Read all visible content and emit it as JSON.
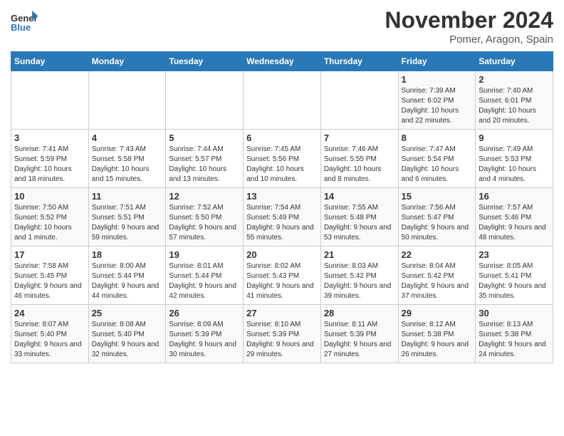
{
  "header": {
    "logo_general": "General",
    "logo_blue": "Blue",
    "title": "November 2024",
    "location": "Pomer, Aragon, Spain"
  },
  "weekdays": [
    "Sunday",
    "Monday",
    "Tuesday",
    "Wednesday",
    "Thursday",
    "Friday",
    "Saturday"
  ],
  "weeks": [
    [
      {
        "day": "",
        "info": ""
      },
      {
        "day": "",
        "info": ""
      },
      {
        "day": "",
        "info": ""
      },
      {
        "day": "",
        "info": ""
      },
      {
        "day": "",
        "info": ""
      },
      {
        "day": "1",
        "info": "Sunrise: 7:39 AM\nSunset: 6:02 PM\nDaylight: 10 hours and 22 minutes."
      },
      {
        "day": "2",
        "info": "Sunrise: 7:40 AM\nSunset: 6:01 PM\nDaylight: 10 hours and 20 minutes."
      }
    ],
    [
      {
        "day": "3",
        "info": "Sunrise: 7:41 AM\nSunset: 5:59 PM\nDaylight: 10 hours and 18 minutes."
      },
      {
        "day": "4",
        "info": "Sunrise: 7:43 AM\nSunset: 5:58 PM\nDaylight: 10 hours and 15 minutes."
      },
      {
        "day": "5",
        "info": "Sunrise: 7:44 AM\nSunset: 5:57 PM\nDaylight: 10 hours and 13 minutes."
      },
      {
        "day": "6",
        "info": "Sunrise: 7:45 AM\nSunset: 5:56 PM\nDaylight: 10 hours and 10 minutes."
      },
      {
        "day": "7",
        "info": "Sunrise: 7:46 AM\nSunset: 5:55 PM\nDaylight: 10 hours and 8 minutes."
      },
      {
        "day": "8",
        "info": "Sunrise: 7:47 AM\nSunset: 5:54 PM\nDaylight: 10 hours and 6 minutes."
      },
      {
        "day": "9",
        "info": "Sunrise: 7:49 AM\nSunset: 5:53 PM\nDaylight: 10 hours and 4 minutes."
      }
    ],
    [
      {
        "day": "10",
        "info": "Sunrise: 7:50 AM\nSunset: 5:52 PM\nDaylight: 10 hours and 1 minute."
      },
      {
        "day": "11",
        "info": "Sunrise: 7:51 AM\nSunset: 5:51 PM\nDaylight: 9 hours and 59 minutes."
      },
      {
        "day": "12",
        "info": "Sunrise: 7:52 AM\nSunset: 5:50 PM\nDaylight: 9 hours and 57 minutes."
      },
      {
        "day": "13",
        "info": "Sunrise: 7:54 AM\nSunset: 5:49 PM\nDaylight: 9 hours and 55 minutes."
      },
      {
        "day": "14",
        "info": "Sunrise: 7:55 AM\nSunset: 5:48 PM\nDaylight: 9 hours and 53 minutes."
      },
      {
        "day": "15",
        "info": "Sunrise: 7:56 AM\nSunset: 5:47 PM\nDaylight: 9 hours and 50 minutes."
      },
      {
        "day": "16",
        "info": "Sunrise: 7:57 AM\nSunset: 5:46 PM\nDaylight: 9 hours and 48 minutes."
      }
    ],
    [
      {
        "day": "17",
        "info": "Sunrise: 7:58 AM\nSunset: 5:45 PM\nDaylight: 9 hours and 46 minutes."
      },
      {
        "day": "18",
        "info": "Sunrise: 8:00 AM\nSunset: 5:44 PM\nDaylight: 9 hours and 44 minutes."
      },
      {
        "day": "19",
        "info": "Sunrise: 8:01 AM\nSunset: 5:44 PM\nDaylight: 9 hours and 42 minutes."
      },
      {
        "day": "20",
        "info": "Sunrise: 8:02 AM\nSunset: 5:43 PM\nDaylight: 9 hours and 41 minutes."
      },
      {
        "day": "21",
        "info": "Sunrise: 8:03 AM\nSunset: 5:42 PM\nDaylight: 9 hours and 39 minutes."
      },
      {
        "day": "22",
        "info": "Sunrise: 8:04 AM\nSunset: 5:42 PM\nDaylight: 9 hours and 37 minutes."
      },
      {
        "day": "23",
        "info": "Sunrise: 8:05 AM\nSunset: 5:41 PM\nDaylight: 9 hours and 35 minutes."
      }
    ],
    [
      {
        "day": "24",
        "info": "Sunrise: 8:07 AM\nSunset: 5:40 PM\nDaylight: 9 hours and 33 minutes."
      },
      {
        "day": "25",
        "info": "Sunrise: 8:08 AM\nSunset: 5:40 PM\nDaylight: 9 hours and 32 minutes."
      },
      {
        "day": "26",
        "info": "Sunrise: 8:09 AM\nSunset: 5:39 PM\nDaylight: 9 hours and 30 minutes."
      },
      {
        "day": "27",
        "info": "Sunrise: 8:10 AM\nSunset: 5:39 PM\nDaylight: 9 hours and 29 minutes."
      },
      {
        "day": "28",
        "info": "Sunrise: 8:11 AM\nSunset: 5:39 PM\nDaylight: 9 hours and 27 minutes."
      },
      {
        "day": "29",
        "info": "Sunrise: 8:12 AM\nSunset: 5:38 PM\nDaylight: 9 hours and 26 minutes."
      },
      {
        "day": "30",
        "info": "Sunrise: 8:13 AM\nSunset: 5:38 PM\nDaylight: 9 hours and 24 minutes."
      }
    ]
  ]
}
